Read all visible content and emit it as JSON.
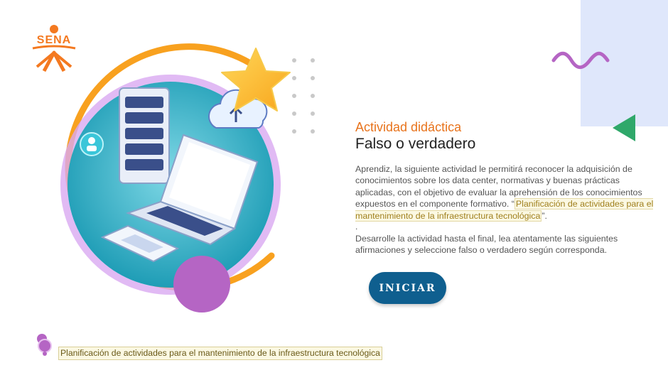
{
  "logo": {
    "text": "SENA"
  },
  "activity": {
    "subtitle": "Actividad didáctica",
    "title": "Falso o verdadero",
    "intro_part1": "Aprendiz, la siguiente actividad le permitirá reconocer la adquisición de conocimientos sobre los data center, normativas y buenas prácticas aplicadas, con el objetivo de evaluar la aprehensión de los conocimientos expuestos en el componente formativo. “",
    "intro_highlight": "Planificación de actividades para el mantenimiento de la infraestructura tecnológica",
    "intro_part2": "”.",
    "separator": ".",
    "instructions": "Desarrolle la actividad hasta el final, lea atentamente las siguientes afirmaciones y seleccione falso o verdadero según corresponda."
  },
  "start_button": {
    "label": "INICIAR"
  },
  "footer": {
    "link_text": "Planificación de actividades para el mantenimiento de la infraestructura tecnológica"
  },
  "colors": {
    "orange": "#f47920",
    "purple": "#b565c4",
    "teal": "#2bb3c6",
    "button": "#0f5f8f",
    "green": "#2fa86a",
    "lavender_bg": "#dfe7fb"
  },
  "icons": [
    "sena-logo",
    "wave-decoration",
    "triangle-decoration",
    "user-icon",
    "cloud-upload-icon",
    "star-icon",
    "server-icon",
    "laptop-icon",
    "pin-icon"
  ]
}
